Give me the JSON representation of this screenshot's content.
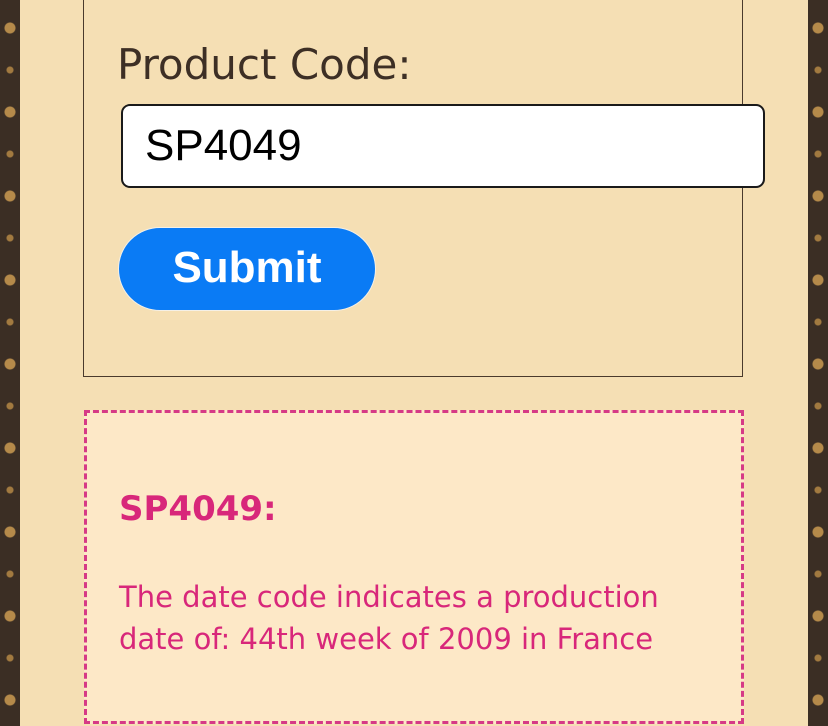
{
  "form": {
    "label": "Product Code:",
    "input_value": "SP4049",
    "submit_label": "Submit"
  },
  "result": {
    "title": "SP4049:",
    "message": "The date code indicates a production date of: 44th week of 2009 in France"
  },
  "colors": {
    "background": "#f5dfb4",
    "button": "#0a7bf5",
    "result_text": "#d8277a",
    "result_border": "#d63a86",
    "pattern_dark": "#3b2e24"
  }
}
